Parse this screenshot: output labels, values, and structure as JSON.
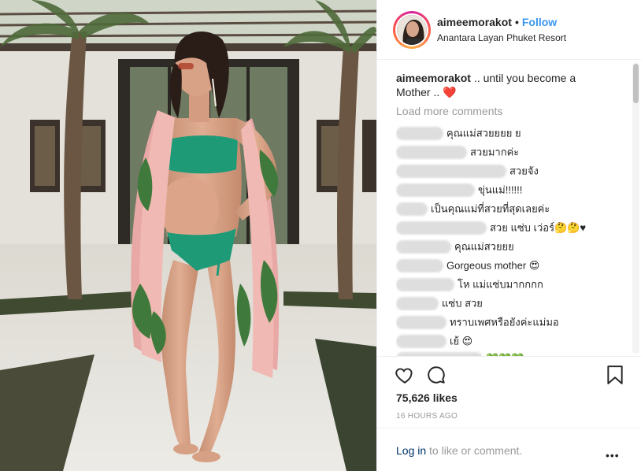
{
  "post": {
    "username": "aimeemorakot",
    "dot": "•",
    "follow_label": "Follow",
    "location": "Anantara Layan Phuket Resort",
    "caption_user": "aimeemorakot",
    "caption_text": ".. until you become a Mother ..",
    "caption_emoji": "❤️",
    "load_more": "Load more comments",
    "likes": "75,626 likes",
    "time": "16 HOURS AGO",
    "login_link": "Log in",
    "login_rest": " to like or comment.",
    "more": "•••"
  },
  "comments": [
    {
      "text": "คุณแม่สวยยยย ย"
    },
    {
      "text": "สวยมากค่ะ"
    },
    {
      "text": "สวยจัง"
    },
    {
      "text": "ขุ่นแม่!!!!!!"
    },
    {
      "text": "เป็นคุณแม่ที่สวยที่สุดเลยค่ะ"
    },
    {
      "text": "สวย แซ่บ เว่อร์🤔🤔♥"
    },
    {
      "text": "คุณแม่สวยยย"
    },
    {
      "text": "Gorgeous mother 😍"
    },
    {
      "text": "โห แม่แซ่บมากกกก"
    },
    {
      "text": "แซ่บ สวย"
    },
    {
      "text": "ทราบเพศหรือยังค่ะแม่มอ"
    },
    {
      "text": "เย้ 😍"
    },
    {
      "text": "💚💚💚"
    }
  ],
  "icons": {
    "like": "heart-icon",
    "comment": "comment-icon",
    "save": "bookmark-icon",
    "more": "more-options-icon"
  },
  "colors": {
    "follow": "#3897f0",
    "muted": "#999999",
    "text": "#262626",
    "swimsuit": "#1f9a77"
  }
}
